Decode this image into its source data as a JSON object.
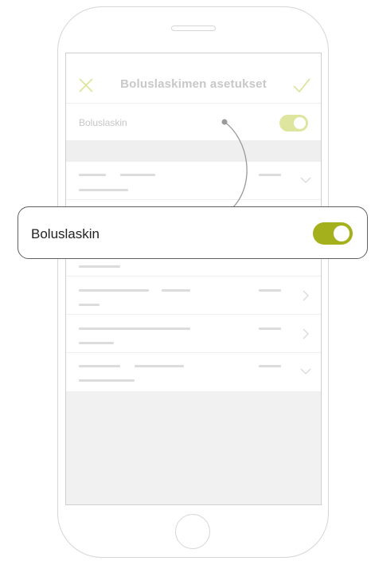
{
  "navbar": {
    "title": "Boluslaskimen asetukset",
    "close_icon": "close-icon",
    "confirm_icon": "checkmark-icon"
  },
  "setting_row": {
    "label": "Boluslaskin",
    "toggle_on": true
  },
  "callout": {
    "label": "Boluslaskin",
    "toggle_on": true
  },
  "colors": {
    "accent": "#a4b11c",
    "accent_faded": "#dde59e",
    "placeholder_bar": "#dcdcdc"
  }
}
